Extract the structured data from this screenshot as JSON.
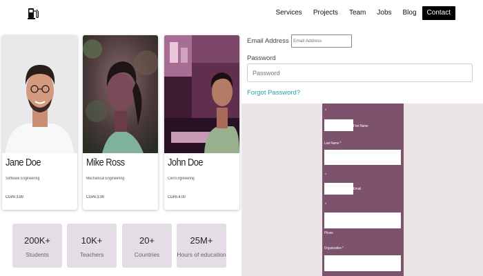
{
  "nav": {
    "items": [
      "Services",
      "Projects",
      "Team",
      "Jobs",
      "Blog"
    ],
    "cta": "Contact"
  },
  "cards": [
    {
      "name": "Jane Doe",
      "major": "Software Engineering",
      "gpa": "CGPA:3.89"
    },
    {
      "name": "Mike Ross",
      "major": "Mechanical Engineering",
      "gpa": "CGPA:3.99"
    },
    {
      "name": "John Doe",
      "major": "Civil Engineering",
      "gpa": "CGPA:4.00"
    }
  ],
  "stats": [
    {
      "value": "200K+",
      "label": "Students"
    },
    {
      "value": "10K+",
      "label": "Teachers"
    },
    {
      "value": "20+",
      "label": "Countries"
    },
    {
      "value": "25M+",
      "label": "Hours of education"
    }
  ],
  "login": {
    "email_label": "Email Address",
    "email_placeholder": "Email Address",
    "password_label": "Password",
    "password_placeholder": "Password",
    "forgot": "Forgot Password?"
  },
  "signup": {
    "mark": "*",
    "first_name": "First Name",
    "last_name": "Last Name *",
    "email": "Email",
    "phone": "Phone",
    "organization": "Organization *"
  },
  "colors": {
    "form_panel": "#7d526c",
    "stat_bg": "#e4dde5",
    "forgot_link": "#2a9dad"
  }
}
